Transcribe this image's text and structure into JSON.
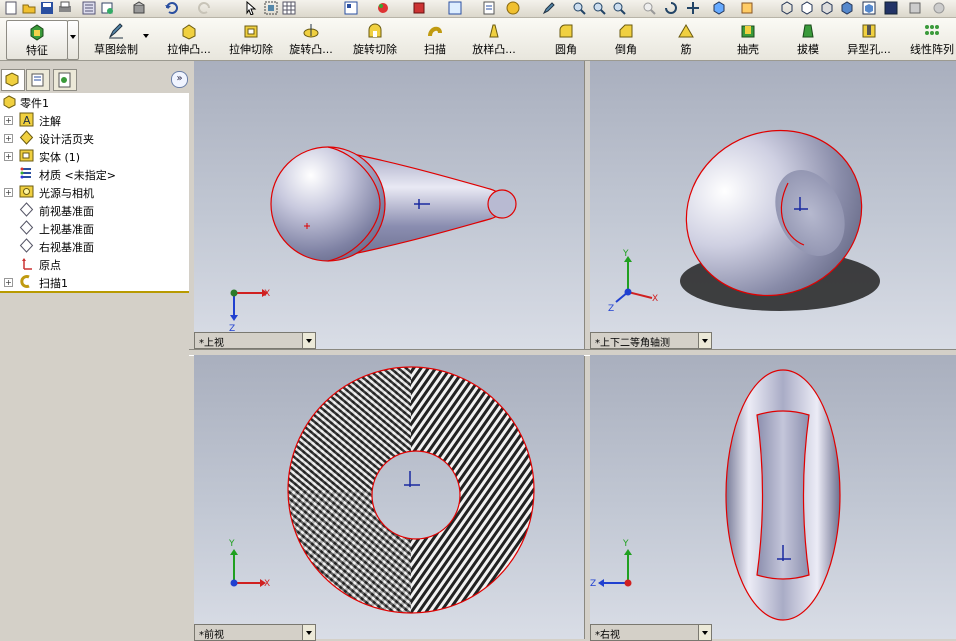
{
  "ribbon": {
    "feature_label": "特征",
    "sketch_label": "草图绘制",
    "extrude_boss": "拉伸凸...",
    "extrude_cut": "拉伸切除",
    "revolve_boss": "旋转凸...",
    "revolve_cut": "旋转切除",
    "sweep": "扫描",
    "loft": "放样凸...",
    "fillet": "圆角",
    "chamfer": "倒角",
    "rib": "筋",
    "shell": "抽壳",
    "draft": "拔模",
    "hole": "异型孔...",
    "pattern": "线性阵列"
  },
  "tree": {
    "root": "零件1",
    "items": [
      {
        "label": "注解",
        "icon": "annotation-icon",
        "expandable": true
      },
      {
        "label": "设计活页夹",
        "icon": "binder-icon",
        "expandable": true
      },
      {
        "label": "实体 (1)",
        "icon": "solid-body-icon",
        "expandable": true
      },
      {
        "label": "材质 <未指定>",
        "icon": "material-icon",
        "expandable": false
      },
      {
        "label": "光源与相机",
        "icon": "lights-icon",
        "expandable": true
      },
      {
        "label": "前视基准面",
        "icon": "plane-icon",
        "expandable": false
      },
      {
        "label": "上视基准面",
        "icon": "plane-icon",
        "expandable": false
      },
      {
        "label": "右视基准面",
        "icon": "plane-icon",
        "expandable": false
      },
      {
        "label": "原点",
        "icon": "origin-icon",
        "expandable": false
      },
      {
        "label": "扫描1",
        "icon": "sweep-feature-icon",
        "expandable": true
      }
    ]
  },
  "viewports": {
    "top": "*上视",
    "iso": "*上下二等角轴测",
    "front": "*前视",
    "right": "*右视"
  },
  "axes": {
    "x": "X",
    "y": "Y",
    "z": "Z"
  },
  "colors": {
    "accent": "#e00000",
    "tree_bar": "#b89a00",
    "axis_x": "#d02020",
    "axis_y": "#20a020",
    "axis_z": "#2040d0"
  }
}
